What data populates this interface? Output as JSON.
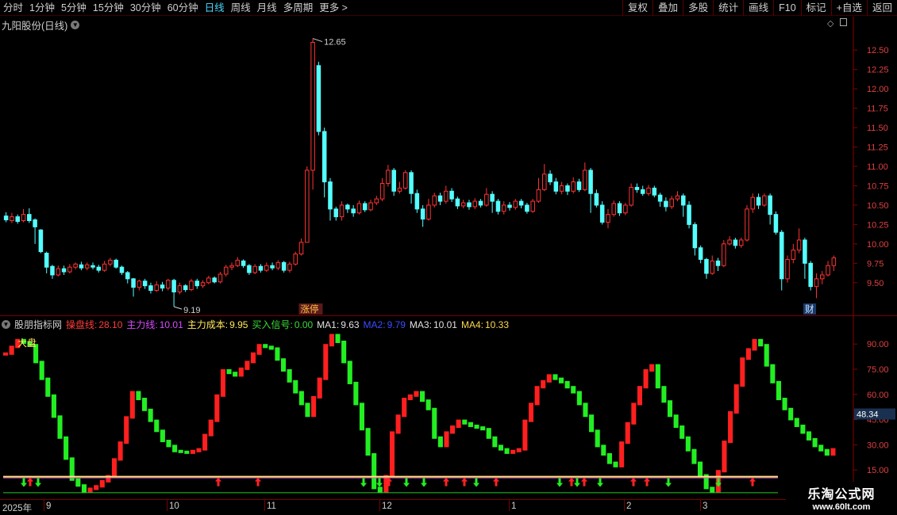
{
  "toolbar": {
    "left": [
      "分时",
      "1分钟",
      "5分钟",
      "15分钟",
      "30分钟",
      "60分钟",
      "日线",
      "周线",
      "月线",
      "多周期",
      "更多 >"
    ],
    "active": "日线",
    "right": [
      "复权",
      "叠加",
      "多股",
      "统计",
      "画线",
      "F10",
      "标记",
      "+自选",
      "返回"
    ]
  },
  "price_panel": {
    "title": "九阳股份(日线)",
    "high_label": "12.65",
    "low_label": "9.19",
    "tag_zhangting": "涨停",
    "tag_cai": "财",
    "axis_ticks": [
      "12.50",
      "12.25",
      "12.00",
      "11.75",
      "11.50",
      "11.25",
      "11.00",
      "10.75",
      "10.50",
      "10.25",
      "10.00",
      "9.75",
      "9.50"
    ]
  },
  "indicator": {
    "name": "股朋指标网",
    "legend": [
      {
        "label": "操盘线:",
        "value": "28.10",
        "color": "#ff3b3b"
      },
      {
        "label": "主力线:",
        "value": "10.01",
        "color": "#d84bff"
      },
      {
        "label": "主力成本:",
        "value": "9.95",
        "color": "#ffe95c"
      },
      {
        "label": "买入信号:",
        "value": "0.00",
        "color": "#3adb3a"
      },
      {
        "label": "MA1:",
        "value": "9.63",
        "color": "#e0e0e0"
      },
      {
        "label": "MA2:",
        "value": "9.79",
        "color": "#3a4cff"
      },
      {
        "label": "MA3:",
        "value": "10.01",
        "color": "#e0e0e0"
      },
      {
        "label": "MA4:",
        "value": "10.33",
        "color": "#ffd84a"
      }
    ],
    "dapan_label": "大盘",
    "axis_ticks": [
      "90.00",
      "75.00",
      "60.00",
      "45.00",
      "30.00",
      "15.00"
    ],
    "current_value": "48.34"
  },
  "date_axis": {
    "year_label": "2025年",
    "months": [
      "9",
      "10",
      "11",
      "12",
      "1",
      "2",
      "3"
    ]
  },
  "watermark": {
    "name": "乐淘公式网",
    "url": "www.60lt.com"
  },
  "chart_data": {
    "type": "candlestick",
    "title": "九阳股份(日线)",
    "ylim": [
      9.15,
      12.85
    ],
    "candles": [
      [
        10.36,
        10.31,
        10.41,
        10.28
      ],
      [
        10.3,
        10.35,
        10.4,
        10.27
      ],
      [
        10.35,
        10.29,
        10.38,
        10.26
      ],
      [
        10.3,
        10.38,
        10.45,
        10.28
      ],
      [
        10.38,
        10.3,
        10.46,
        10.27
      ],
      [
        10.31,
        10.22,
        10.33,
        10.0
      ],
      [
        10.18,
        9.9,
        10.19,
        9.88
      ],
      [
        9.88,
        9.7,
        9.9,
        9.62
      ],
      [
        9.71,
        9.6,
        9.73,
        9.55
      ],
      [
        9.6,
        9.68,
        9.72,
        9.58
      ],
      [
        9.68,
        9.64,
        9.72,
        9.6
      ],
      [
        9.64,
        9.7,
        9.74,
        9.62
      ],
      [
        9.7,
        9.74,
        9.76,
        9.67
      ],
      [
        9.73,
        9.69,
        9.77,
        9.66
      ],
      [
        9.69,
        9.73,
        9.76,
        9.66
      ],
      [
        9.72,
        9.7,
        9.76,
        9.67
      ],
      [
        9.7,
        9.66,
        9.73,
        9.63
      ],
      [
        9.66,
        9.74,
        9.78,
        9.64
      ],
      [
        9.74,
        9.79,
        9.82,
        9.71
      ],
      [
        9.79,
        9.7,
        9.81,
        9.68
      ],
      [
        9.7,
        9.63,
        9.72,
        9.6
      ],
      [
        9.63,
        9.55,
        9.65,
        9.49
      ],
      [
        9.55,
        9.44,
        9.56,
        9.32
      ],
      [
        9.44,
        9.52,
        9.54,
        9.4
      ],
      [
        9.52,
        9.46,
        9.55,
        9.42
      ],
      [
        9.46,
        9.4,
        9.5,
        9.36
      ],
      [
        9.4,
        9.47,
        9.52,
        9.38
      ],
      [
        9.47,
        9.43,
        9.51,
        9.39
      ],
      [
        9.43,
        9.53,
        9.55,
        9.4
      ],
      [
        9.53,
        9.38,
        9.55,
        9.19
      ],
      [
        9.38,
        9.46,
        9.5,
        9.35
      ],
      [
        9.46,
        9.41,
        9.48,
        9.38
      ],
      [
        9.41,
        9.52,
        9.55,
        9.39
      ],
      [
        9.52,
        9.46,
        9.55,
        9.42
      ],
      [
        9.46,
        9.5,
        9.53,
        9.43
      ],
      [
        9.5,
        9.56,
        9.59,
        9.48
      ],
      [
        9.56,
        9.51,
        9.58,
        9.49
      ],
      [
        9.51,
        9.61,
        9.64,
        9.49
      ],
      [
        9.61,
        9.7,
        9.73,
        9.58
      ],
      [
        9.7,
        9.72,
        9.76,
        9.66
      ],
      [
        9.72,
        9.79,
        9.83,
        9.7
      ],
      [
        9.78,
        9.72,
        9.8,
        9.69
      ],
      [
        9.72,
        9.63,
        9.74,
        9.6
      ],
      [
        9.63,
        9.71,
        9.74,
        9.61
      ],
      [
        9.71,
        9.66,
        9.74,
        9.63
      ],
      [
        9.66,
        9.72,
        9.76,
        9.64
      ],
      [
        9.72,
        9.69,
        9.76,
        9.66
      ],
      [
        9.69,
        9.76,
        9.79,
        9.66
      ],
      [
        9.76,
        9.66,
        9.78,
        9.63
      ],
      [
        9.66,
        9.74,
        9.77,
        9.63
      ],
      [
        9.74,
        9.87,
        9.9,
        9.72
      ],
      [
        9.87,
        10.02,
        10.07,
        9.85
      ],
      [
        10.02,
        10.95,
        11.0,
        10.3
      ],
      [
        10.95,
        12.6,
        12.65,
        10.7
      ],
      [
        12.3,
        11.45,
        12.35,
        11.4
      ],
      [
        11.45,
        10.8,
        11.5,
        10.6
      ],
      [
        10.8,
        10.45,
        10.85,
        10.3
      ],
      [
        10.45,
        10.35,
        10.48,
        10.3
      ],
      [
        10.35,
        10.5,
        10.55,
        10.3
      ],
      [
        10.5,
        10.45,
        10.52,
        10.4
      ],
      [
        10.45,
        10.4,
        10.5,
        10.35
      ],
      [
        10.4,
        10.52,
        10.56,
        10.38
      ],
      [
        10.52,
        10.44,
        10.55,
        10.41
      ],
      [
        10.44,
        10.53,
        10.57,
        10.42
      ],
      [
        10.53,
        10.58,
        10.62,
        10.5
      ],
      [
        10.58,
        10.78,
        10.85,
        10.55
      ],
      [
        10.78,
        10.95,
        11.02,
        10.74
      ],
      [
        10.95,
        10.68,
        10.98,
        10.62
      ],
      [
        10.68,
        10.72,
        10.8,
        10.65
      ],
      [
        10.72,
        10.92,
        10.95,
        10.7
      ],
      [
        10.92,
        10.65,
        10.95,
        10.52
      ],
      [
        10.65,
        10.45,
        10.7,
        10.4
      ],
      [
        10.45,
        10.32,
        10.5,
        10.22
      ],
      [
        10.32,
        10.5,
        10.58,
        10.3
      ],
      [
        10.5,
        10.62,
        10.66,
        10.47
      ],
      [
        10.62,
        10.55,
        10.66,
        10.5
      ],
      [
        10.55,
        10.68,
        10.75,
        10.52
      ],
      [
        10.68,
        10.58,
        10.72,
        10.54
      ],
      [
        10.58,
        10.49,
        10.61,
        10.45
      ],
      [
        10.49,
        10.53,
        10.57,
        10.46
      ],
      [
        10.53,
        10.48,
        10.57,
        10.44
      ],
      [
        10.48,
        10.55,
        10.59,
        10.45
      ],
      [
        10.55,
        10.5,
        10.58,
        10.47
      ],
      [
        10.5,
        10.64,
        10.72,
        10.48
      ],
      [
        10.64,
        10.55,
        10.68,
        10.4
      ],
      [
        10.55,
        10.42,
        10.58,
        10.38
      ],
      [
        10.42,
        10.5,
        10.55,
        10.38
      ],
      [
        10.5,
        10.47,
        10.54,
        10.43
      ],
      [
        10.47,
        10.55,
        10.58,
        10.44
      ],
      [
        10.55,
        10.5,
        10.58,
        10.46
      ],
      [
        10.5,
        10.42,
        10.53,
        10.39
      ],
      [
        10.42,
        10.55,
        10.58,
        10.4
      ],
      [
        10.55,
        10.7,
        10.85,
        10.53
      ],
      [
        10.7,
        10.9,
        11.03,
        10.68
      ],
      [
        10.9,
        10.8,
        10.95,
        10.76
      ],
      [
        10.8,
        10.68,
        10.85,
        10.64
      ],
      [
        10.68,
        10.75,
        10.8,
        10.64
      ],
      [
        10.75,
        10.68,
        10.78,
        10.63
      ],
      [
        10.68,
        10.8,
        10.86,
        10.65
      ],
      [
        10.8,
        10.7,
        10.84,
        10.67
      ],
      [
        10.7,
        10.95,
        11.05,
        10.68
      ],
      [
        10.95,
        10.65,
        10.98,
        10.4
      ],
      [
        10.65,
        10.5,
        10.7,
        10.47
      ],
      [
        10.5,
        10.28,
        10.55,
        10.25
      ],
      [
        10.28,
        10.38,
        10.45,
        10.2
      ],
      [
        10.38,
        10.52,
        10.56,
        10.35
      ],
      [
        10.52,
        10.4,
        10.55,
        10.36
      ],
      [
        10.4,
        10.5,
        10.53,
        10.37
      ],
      [
        10.5,
        10.73,
        10.78,
        10.48
      ],
      [
        10.73,
        10.7,
        10.78,
        10.66
      ],
      [
        10.7,
        10.65,
        10.75,
        10.62
      ],
      [
        10.65,
        10.72,
        10.76,
        10.62
      ],
      [
        10.72,
        10.63,
        10.75,
        10.6
      ],
      [
        10.63,
        10.55,
        10.66,
        10.48
      ],
      [
        10.55,
        10.48,
        10.6,
        10.42
      ],
      [
        10.48,
        10.58,
        10.62,
        10.45
      ],
      [
        10.58,
        10.62,
        10.68,
        10.55
      ],
      [
        10.62,
        10.5,
        10.65,
        10.35
      ],
      [
        10.5,
        10.25,
        10.55,
        10.2
      ],
      [
        10.25,
        9.95,
        10.28,
        9.85
      ],
      [
        9.95,
        9.8,
        9.98,
        9.75
      ],
      [
        9.8,
        9.62,
        9.82,
        9.55
      ],
      [
        9.62,
        9.78,
        9.85,
        9.6
      ],
      [
        9.78,
        9.72,
        9.82,
        9.65
      ],
      [
        9.72,
        10.0,
        10.05,
        9.7
      ],
      [
        10.0,
        10.05,
        10.1,
        9.98
      ],
      [
        10.05,
        9.98,
        10.08,
        9.94
      ],
      [
        9.98,
        10.05,
        10.08,
        9.95
      ],
      [
        10.05,
        10.45,
        10.5,
        10.03
      ],
      [
        10.45,
        10.6,
        10.65,
        10.4
      ],
      [
        10.6,
        10.5,
        10.65,
        10.45
      ],
      [
        10.5,
        10.62,
        10.65,
        10.48
      ],
      [
        10.62,
        10.38,
        10.65,
        10.25
      ],
      [
        10.38,
        10.15,
        10.42,
        10.12
      ],
      [
        10.15,
        9.55,
        10.18,
        9.4
      ],
      [
        9.55,
        9.8,
        9.85,
        9.5
      ],
      [
        9.8,
        9.92,
        10.0,
        9.75
      ],
      [
        9.92,
        10.05,
        10.2,
        9.88
      ],
      [
        10.05,
        9.75,
        10.08,
        9.55
      ],
      [
        9.75,
        9.45,
        9.78,
        9.4
      ],
      [
        9.45,
        9.55,
        9.62,
        9.3
      ],
      [
        9.55,
        9.6,
        9.65,
        9.48
      ],
      [
        9.6,
        9.72,
        9.78,
        9.58
      ],
      [
        9.72,
        9.82,
        9.85,
        9.65
      ]
    ]
  }
}
